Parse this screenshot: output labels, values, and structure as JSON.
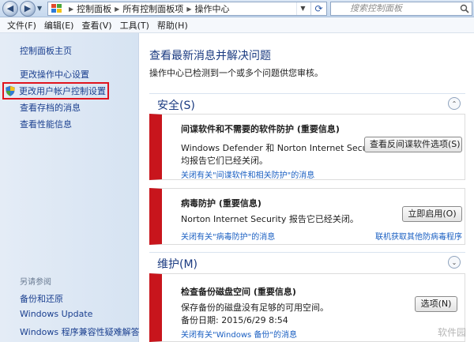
{
  "address": {
    "crumbs": [
      "控制面板",
      "所有控制面板项",
      "操作中心"
    ],
    "search_placeholder": "搜索控制面板"
  },
  "menu": [
    "文件(F)",
    "编辑(E)",
    "查看(V)",
    "工具(T)",
    "帮助(H)"
  ],
  "sidebar": {
    "home": "控制面板主页",
    "items": [
      "更改操作中心设置",
      "更改用户帐户控制设置",
      "查看存档的消息",
      "查看性能信息"
    ],
    "see_also_heading": "另请参阅",
    "see_also": [
      "备份和还原",
      "Windows Update",
      "Windows 程序兼容性疑难解答"
    ]
  },
  "main": {
    "title": "查看最新消息并解决问题",
    "subtitle": "操作中心已检测到一个或多个问题供您审核。",
    "security": {
      "label": "安全(S)",
      "messages": [
        {
          "title": "间谍软件和不需要的软件防护 (重要信息)",
          "line1": "Windows Defender 和 Norton Internet Security",
          "line2": "均报告它们已经关闭。",
          "link": "关闭有关\"间谍软件和相关防护\"的消息",
          "button": "查看反间谍软件选项(S)"
        },
        {
          "title": "病毒防护 (重要信息)",
          "line1": "Norton Internet Security 报告它已经关闭。",
          "link": "关闭有关\"病毒防护\"的消息",
          "link2": "联机获取其他防病毒程序",
          "button": "立即启用(O)"
        }
      ]
    },
    "maintenance": {
      "label": "维护(M)",
      "messages": [
        {
          "title": "检查备份磁盘空间 (重要信息)",
          "line1": "保存备份的磁盘没有足够的可用空间。",
          "line2": "备份日期: 2015/6/29 8:54",
          "link": "关闭有关\"Windows 备份\"的消息",
          "button": "选项(N)"
        }
      ]
    }
  },
  "watermark": "软件园"
}
